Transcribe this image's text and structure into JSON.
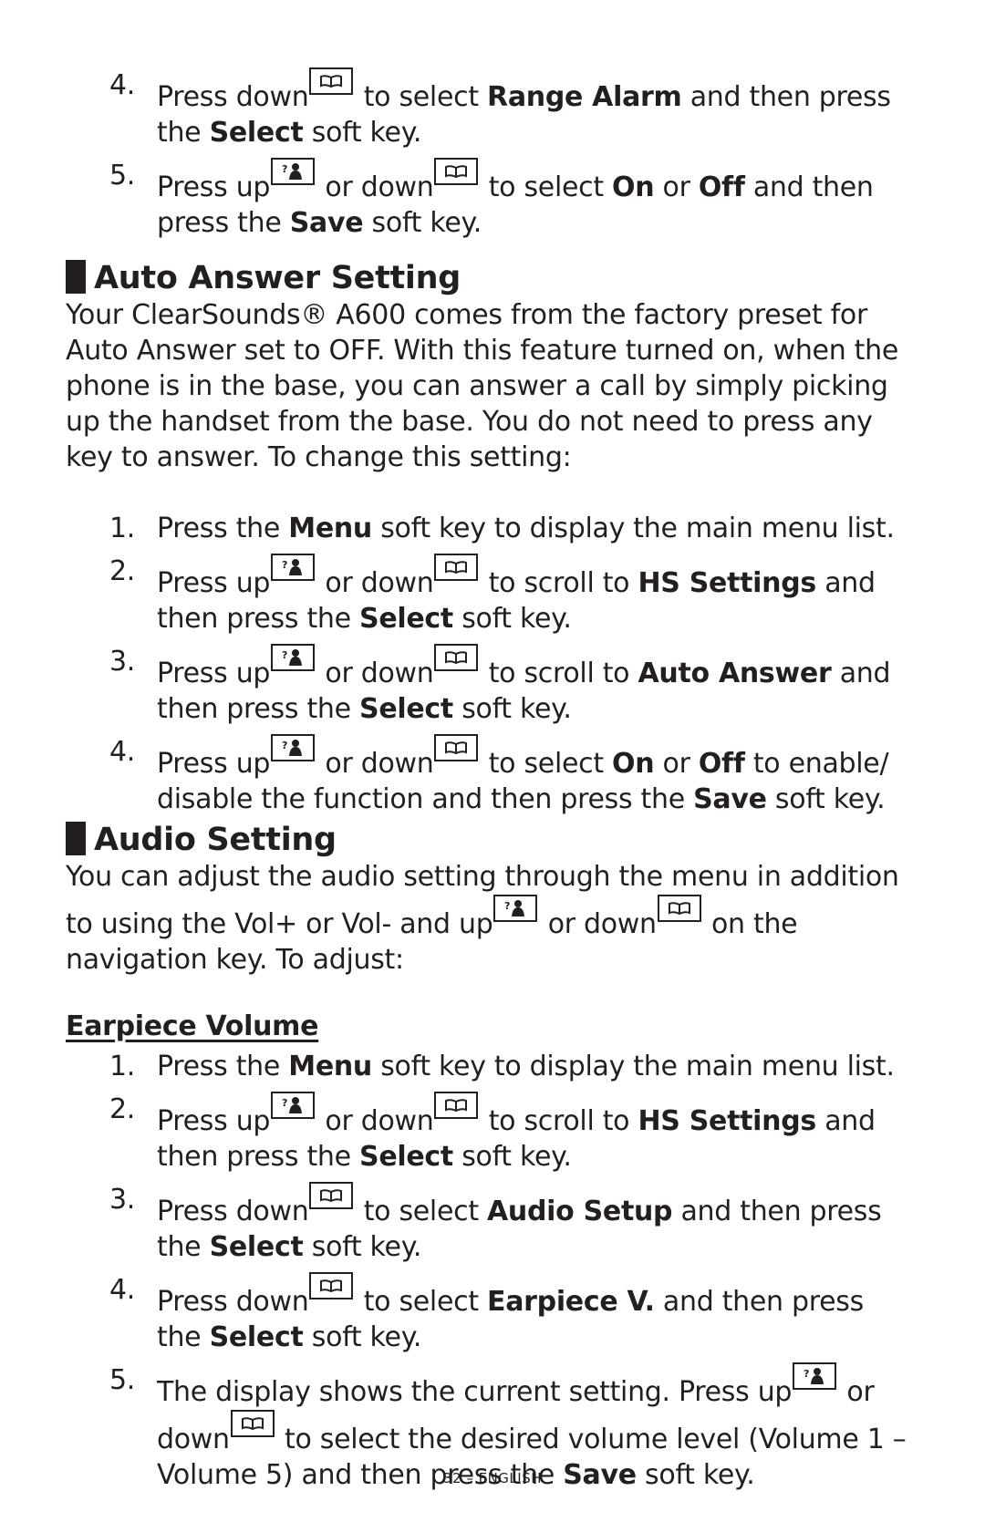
{
  "icons": {
    "up": "up-key-icon",
    "down": "down-key-icon"
  },
  "continued_steps": [
    {
      "num": "4.",
      "pre": "Press down",
      "mid": " to select ",
      "b1": "Range Alarm",
      "mid2": " and then press",
      "line2pre": "the ",
      "b2": "Select",
      "post": " soft key."
    },
    {
      "num": "5.",
      "pre": "Press up",
      "or": " or down",
      "mid": " to select ",
      "b1": "On",
      "or2": " or ",
      "b2": "Off",
      "mid2": " and then",
      "line2pre": "press the ",
      "b3": "Save",
      "post": " soft key."
    }
  ],
  "auto_answer": {
    "title": "Auto Answer Setting",
    "intro": "Your ClearSounds® A600 comes from the factory preset for Auto Answer set to OFF. With this feature turned on, when the phone is in the base, you can answer a call by simply picking up the handset from the base.  You do not need to press any key to answer.  To change this setting:",
    "steps": [
      {
        "num": "1.",
        "pre": "Press the ",
        "b1": "Menu",
        "post": " soft key to display the main menu list."
      },
      {
        "num": "2.",
        "pre": "Press up",
        "or": " or down",
        "mid": " to scroll to ",
        "b1": "HS Settings",
        "mid2": " and then press the ",
        "b2": "Select",
        "post": " soft key."
      },
      {
        "num": "3.",
        "pre": "Press up",
        "or": " or down",
        "mid": " to scroll to ",
        "b1": "Auto Answer",
        "mid2": " and then press the ",
        "b2": "Select",
        "post": " soft key."
      },
      {
        "num": "4.",
        "pre": "Press up",
        "or": " or down",
        "mid": " to select ",
        "b1": "On",
        "or2": " or ",
        "b2": "Off",
        "mid2": " to enable/ disable the function and then press the ",
        "b3": "Save",
        "post": " soft key."
      }
    ]
  },
  "audio": {
    "title": "Audio Setting",
    "intro_a": "You can adjust the audio setting through the menu in addition to using the Vol+ or Vol- and up",
    "intro_b": " or down",
    "intro_c": " on the navigation key.  To adjust:",
    "subheading": "Earpiece Volume",
    "steps": [
      {
        "num": "1.",
        "pre": "Press the ",
        "b1": "Menu",
        "post": " soft key to display the main menu list."
      },
      {
        "num": "2.",
        "pre": "Press up",
        "or": " or down",
        "mid": " to scroll to ",
        "b1": "HS Settings",
        "mid2": " and then press the ",
        "b2": "Select",
        "post": " soft key."
      },
      {
        "num": "3.",
        "pre": "Press down",
        "mid": " to select ",
        "b1": "Audio Setup",
        "mid2": " and then press the ",
        "b2": "Select",
        "post": " soft key."
      },
      {
        "num": "4.",
        "pre": "Press down",
        "mid": " to select ",
        "b1": "Earpiece V.",
        "mid2": " and then press the ",
        "b2": "Select",
        "post": " soft key."
      },
      {
        "num": "5.",
        "pre": "The display shows the current setting.  Press up",
        "or": " or down",
        "mid": " to select the desired volume level (Volume 1 – Volume 5) and then press the ",
        "b1": "Save",
        "post": " soft key."
      }
    ]
  },
  "footer": "32 – ENGLISH"
}
